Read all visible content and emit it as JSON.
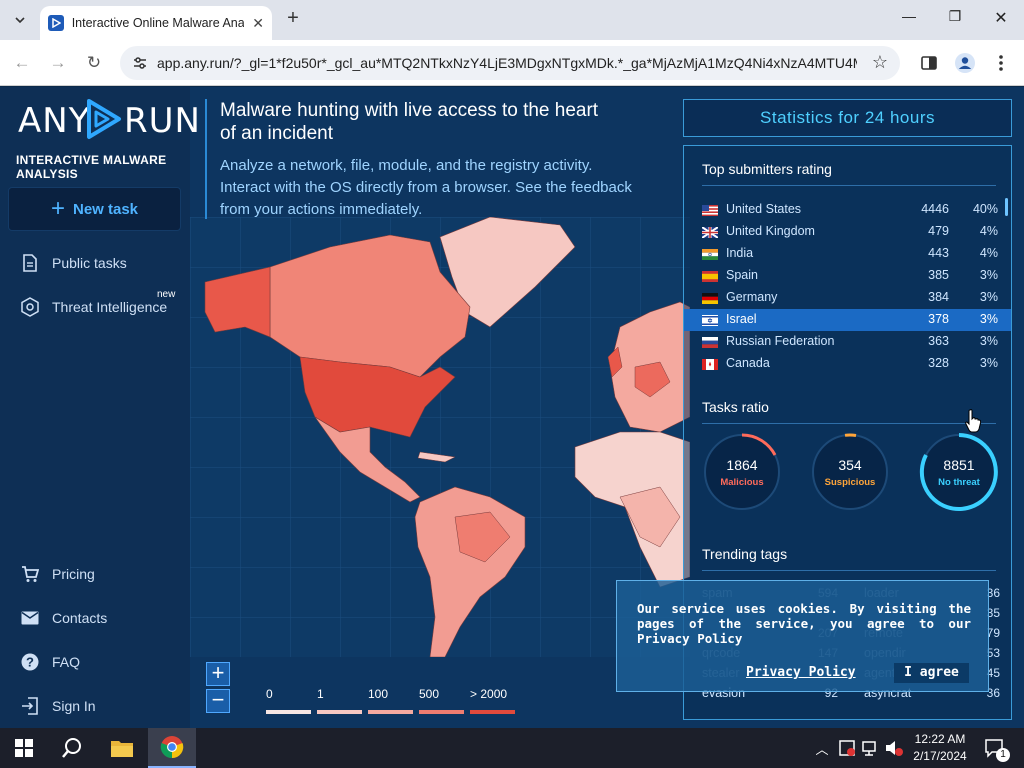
{
  "browser": {
    "tab_title": "Interactive Online Malware Ana",
    "url": "app.any.run/?_gl=1*f2u50r*_gcl_au*MTQ2NTkxNzY4LjE3MDgxNTgxMDk.*_ga*MjAzMjA1MzQ4Ni4xNzA4MTU4M..."
  },
  "sidebar": {
    "logo_left": "ANY",
    "logo_right": "RUN",
    "logo_sub": "INTERACTIVE MALWARE ANALYSIS",
    "new_task": "New task",
    "items": [
      {
        "label": "Public tasks"
      },
      {
        "label": "Threat Intelligence",
        "badge": "new"
      },
      {
        "label": "Pricing"
      },
      {
        "label": "Contacts"
      },
      {
        "label": "FAQ"
      },
      {
        "label": "Sign In"
      }
    ]
  },
  "hero": {
    "title": "Malware hunting with live access to the heart of an incident",
    "subtitle": "Analyze a network, file, module, and the registry activity. Interact with the OS directly from a browser. See the feedback from your actions immediately."
  },
  "map_legend": [
    "0",
    "1",
    "100",
    "500",
    "> 2000"
  ],
  "map_zoom": {
    "in": "+",
    "out": "−"
  },
  "stats": {
    "header": "Statistics for 24 hours",
    "submitters_title": "Top submitters rating",
    "submitters": [
      {
        "country": "United States",
        "count": "4446",
        "pct": "40%"
      },
      {
        "country": "United Kingdom",
        "count": "479",
        "pct": "4%"
      },
      {
        "country": "India",
        "count": "443",
        "pct": "4%"
      },
      {
        "country": "Spain",
        "count": "385",
        "pct": "3%"
      },
      {
        "country": "Germany",
        "count": "384",
        "pct": "3%"
      },
      {
        "country": "Israel",
        "count": "378",
        "pct": "3%"
      },
      {
        "country": "Russian Federation",
        "count": "363",
        "pct": "3%"
      },
      {
        "country": "Canada",
        "count": "328",
        "pct": "3%"
      }
    ],
    "ratio_title": "Tasks ratio",
    "ratio": [
      {
        "value": "1864",
        "label": "Malicious",
        "color": "#ff6b5b"
      },
      {
        "value": "354",
        "label": "Suspicious",
        "color": "#ffa53a"
      },
      {
        "value": "8851",
        "label": "No threat",
        "color": "#3ad0ff"
      }
    ],
    "tags_title": "Trending tags",
    "tags": [
      {
        "left": "spam",
        "left_count": "594",
        "right": "loader",
        "right_count": "36"
      },
      {
        "left": "",
        "left_count": "",
        "right": "",
        "right_count": "35"
      },
      {
        "left": "",
        "left_count": "207",
        "right": "remote",
        "right_count": "79"
      },
      {
        "left": "qrcode",
        "left_count": "147",
        "right": "opendir",
        "right_count": "53"
      },
      {
        "left": "stealer",
        "left_count": "",
        "right": "agent",
        "right_count": "45"
      },
      {
        "left": "evasion",
        "left_count": "92",
        "right": "asyncrat",
        "right_count": "36"
      }
    ]
  },
  "cookie": {
    "text": "Our service uses cookies. By visiting the pages of the service, you agree to our Privacy Policy",
    "link": "Privacy Policy",
    "button": "I agree"
  },
  "taskbar": {
    "time": "12:22 AM",
    "date": "2/17/2024",
    "notif_count": "1"
  }
}
